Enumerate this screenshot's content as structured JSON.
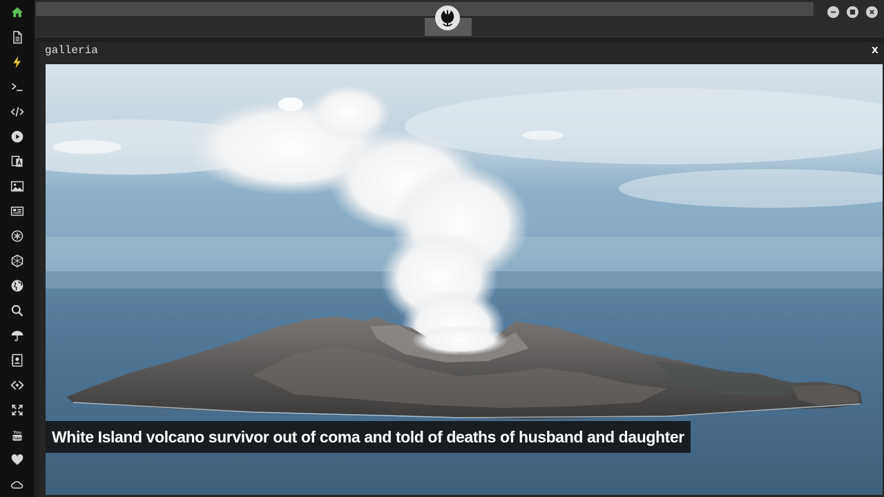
{
  "sidebar": {
    "items": [
      {
        "icon": "home-icon",
        "color": "#5bbf5b"
      },
      {
        "icon": "document-icon"
      },
      {
        "icon": "lightning-icon",
        "color": "#e8c43a"
      },
      {
        "icon": "terminal-icon"
      },
      {
        "icon": "code-icon"
      },
      {
        "icon": "play-circle-icon"
      },
      {
        "icon": "translate-icon"
      },
      {
        "icon": "image-icon"
      },
      {
        "icon": "newspaper-icon"
      },
      {
        "icon": "asterisk-circle-icon"
      },
      {
        "icon": "hexagon-icon"
      },
      {
        "icon": "globe-icon"
      },
      {
        "icon": "search-icon"
      },
      {
        "icon": "umbrella-icon"
      },
      {
        "icon": "contacts-icon"
      },
      {
        "icon": "code-diamond-icon"
      },
      {
        "icon": "expand-icon"
      },
      {
        "icon": "youtube-icon"
      },
      {
        "icon": "heart-icon"
      },
      {
        "icon": "cloud-icon"
      }
    ]
  },
  "topbar": {
    "logo": "rebel-alliance-icon",
    "buttons": [
      "minimize-icon",
      "maximize-icon",
      "close-icon"
    ]
  },
  "window": {
    "title": "galleria",
    "close_label": "x",
    "image": {
      "subject": "volcano-island-icon",
      "caption": "White Island volcano survivor out of coma and told of deaths of husband and daughter"
    }
  },
  "colors": {
    "sidebar_bg": "#111111",
    "topbar_bg": "#2b2b2b",
    "accent_green": "#5bbf5b",
    "accent_yellow": "#e8c43a"
  }
}
